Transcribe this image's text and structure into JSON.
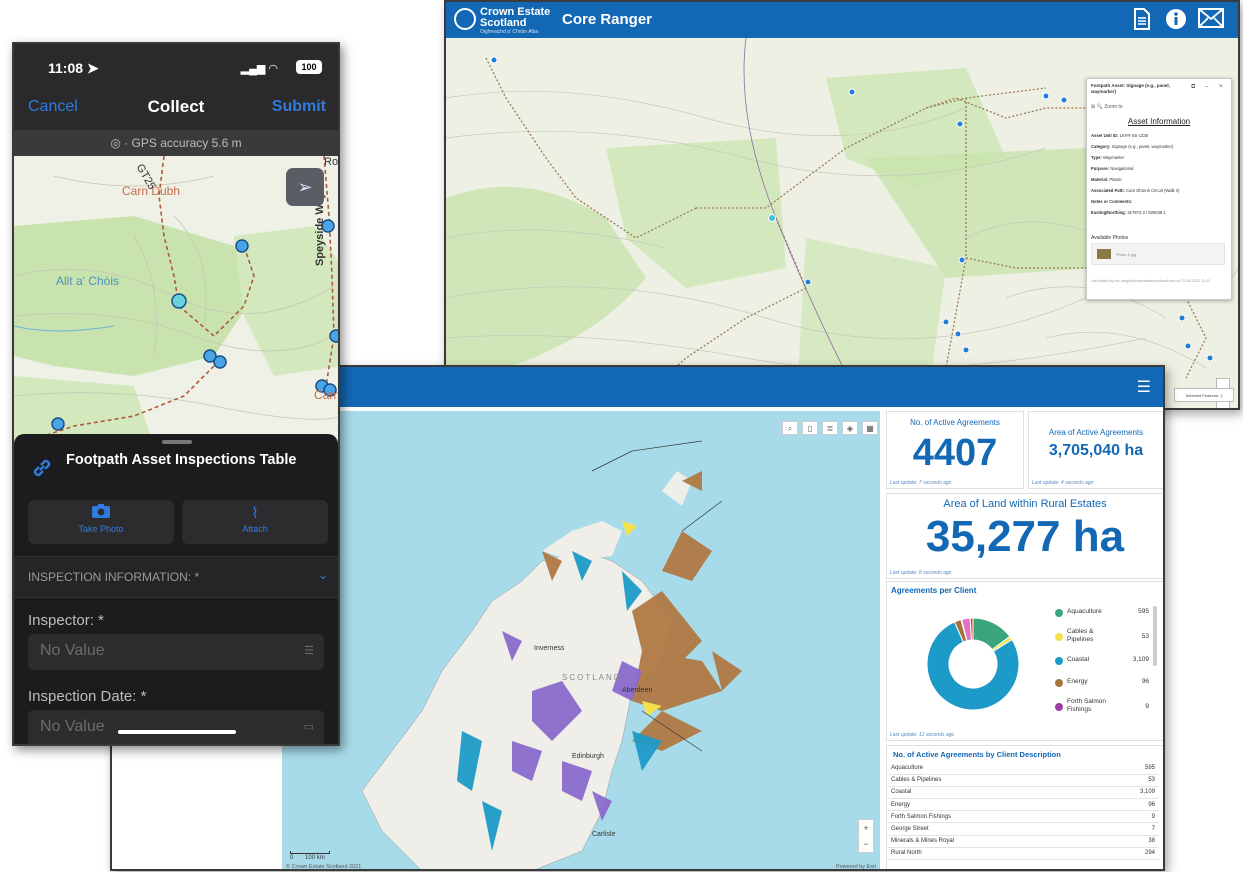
{
  "ranger": {
    "logo_line1": "Crown Estate",
    "logo_line2": "Scotland",
    "logo_sub": "Oighreachd a' Chrùin Alba",
    "title": "Core Ranger",
    "popup": {
      "title": "Footpath Asset: Signage (e.g., panel, waymarker)",
      "search_placeholder": "Zoom to",
      "heading": "Asset Information",
      "rows": [
        {
          "k": "Asset Unit ID:",
          "v": "LKFR-SS-1336"
        },
        {
          "k": "Category:",
          "v": "Signage (e.g., panel, waymarker)"
        },
        {
          "k": "Type:",
          "v": "Waymarker"
        },
        {
          "k": "Purpose:",
          "v": "Navigational"
        },
        {
          "k": "Material:",
          "v": "Plastic"
        },
        {
          "k": "Associated Path:",
          "v": "Carn Dhomh Circuit (Walk 3)"
        },
        {
          "k": "Notes or Comments:",
          "v": ""
        },
        {
          "k": "Easting/Northing:",
          "v": "317872.3 / 825639.1"
        }
      ],
      "photos_title": "Available Photos",
      "photo_name": "Photo 1.jpg",
      "footer": "Last edited by ctlc.ranger@crownestatescotland.com on 22.08.2023, 11:22"
    },
    "selected_label": "Selected Features: 1"
  },
  "dashboard": {
    "active_agreements": {
      "title": "No. of Active Agreements",
      "value": "4407",
      "updated": "Last update: 7 seconds ago"
    },
    "area_agreements": {
      "title": "Area of Active Agreements",
      "value": "3,705,040 ha",
      "updated": "Last update: 4 seconds ago"
    },
    "rural_area": {
      "title": "Area of Land within Rural Estates",
      "value": "35,277 ha",
      "updated": "Last update: 8 seconds ago"
    },
    "per_client": {
      "title": "Agreements per Client",
      "updated": "Last update: 12 seconds ago",
      "legend": [
        {
          "label": "Aquaculture",
          "value": "595",
          "color": "#3aa57a"
        },
        {
          "label": "Cables & Pipelines",
          "value": "53",
          "color": "#f2e14a"
        },
        {
          "label": "Coastal",
          "value": "3,109",
          "color": "#1d9bc8"
        },
        {
          "label": "Energy",
          "value": "96",
          "color": "#a8733a"
        },
        {
          "label": "Forth Salmon Fishings",
          "value": "9",
          "color": "#9b3fa3"
        }
      ]
    },
    "by_description": {
      "title": "No. of Active Agreements by Client Description",
      "rows": [
        {
          "k": "Aquaculture",
          "v": "595"
        },
        {
          "k": "Cables & Pipelines",
          "v": "53"
        },
        {
          "k": "Coastal",
          "v": "3,109"
        },
        {
          "k": "Energy",
          "v": "96"
        },
        {
          "k": "Forth Salmon Fishings",
          "v": "9"
        },
        {
          "k": "George Street",
          "v": "7"
        },
        {
          "k": "Minerals & Mines Royal",
          "v": "38"
        },
        {
          "k": "Rural North",
          "v": "294"
        }
      ]
    },
    "map": {
      "labels": {
        "inverness": "Inverness",
        "scotland": "SCOTLAND",
        "aberdeen": "Aberdeen",
        "edinburgh": "Edinburgh",
        "carlisle": "Carlisle"
      },
      "scale_zero": "0",
      "scale_km": "100 km",
      "copyright": "© Crown Estate Scotland 2021",
      "powered": "Powered by Esri"
    }
  },
  "phone": {
    "time": "11:08",
    "battery": "100",
    "cancel": "Cancel",
    "title": "Collect",
    "submit": "Submit",
    "gps": "GPS accuracy 5.6 m",
    "map_labels": {
      "carn_dubh": "Carn Dubh",
      "allt": "Allt a' Chòis",
      "speyside": "Speyside Way",
      "gt": "GT25",
      "carn": "Carn",
      "ro": "Ro"
    },
    "table_name": "Footpath Asset Inspections Table",
    "take_photo": "Take Photo",
    "attach": "Attach",
    "section": "INSPECTION INFORMATION: *",
    "inspector_label": "Inspector: *",
    "inspector_value": "No Value",
    "date_label": "Inspection Date: *",
    "date_value": "No Value"
  }
}
